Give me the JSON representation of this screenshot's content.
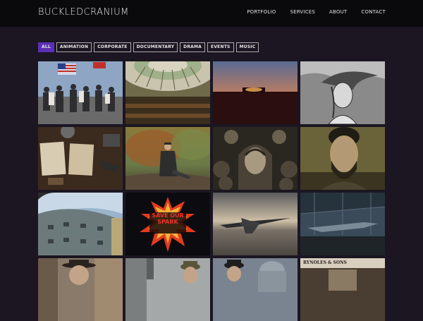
{
  "site": {
    "logo": "BUCKLEDCRANIUM"
  },
  "nav": [
    "PORTFOLIO",
    "SERVICES",
    "ABOUT",
    "CONTACT"
  ],
  "filters": [
    {
      "label": "ALL",
      "active": true
    },
    {
      "label": "ANIMATION",
      "active": false
    },
    {
      "label": "CORPORATE",
      "active": false
    },
    {
      "label": "DOCUMENTARY",
      "active": false
    },
    {
      "label": "DRAMA",
      "active": false
    },
    {
      "label": "EVENTS",
      "active": false
    },
    {
      "label": "MUSIC",
      "active": false
    }
  ],
  "tiles": [
    {
      "name": "thumb-flag-crowd"
    },
    {
      "name": "thumb-library-dome"
    },
    {
      "name": "thumb-sunset-horizon"
    },
    {
      "name": "thumb-woman-sketch"
    },
    {
      "name": "thumb-desk-papers"
    },
    {
      "name": "thumb-man-reading"
    },
    {
      "name": "thumb-ornate-woman"
    },
    {
      "name": "thumb-bearded-man"
    },
    {
      "name": "thumb-fort-tower"
    },
    {
      "name": "thumb-save-our-spark",
      "text": "SAVE OUR SPARK"
    },
    {
      "name": "thumb-fighter-plane"
    },
    {
      "name": "thumb-hangar-plane"
    },
    {
      "name": "thumb-man-hat"
    },
    {
      "name": "thumb-soldier"
    },
    {
      "name": "thumb-city-men"
    },
    {
      "name": "thumb-shopfront",
      "text": "RYNOLES & SONS"
    }
  ],
  "colors": {
    "accent": "#5b2fb6",
    "topbar": "#0a090c",
    "background": "#1b1622"
  }
}
